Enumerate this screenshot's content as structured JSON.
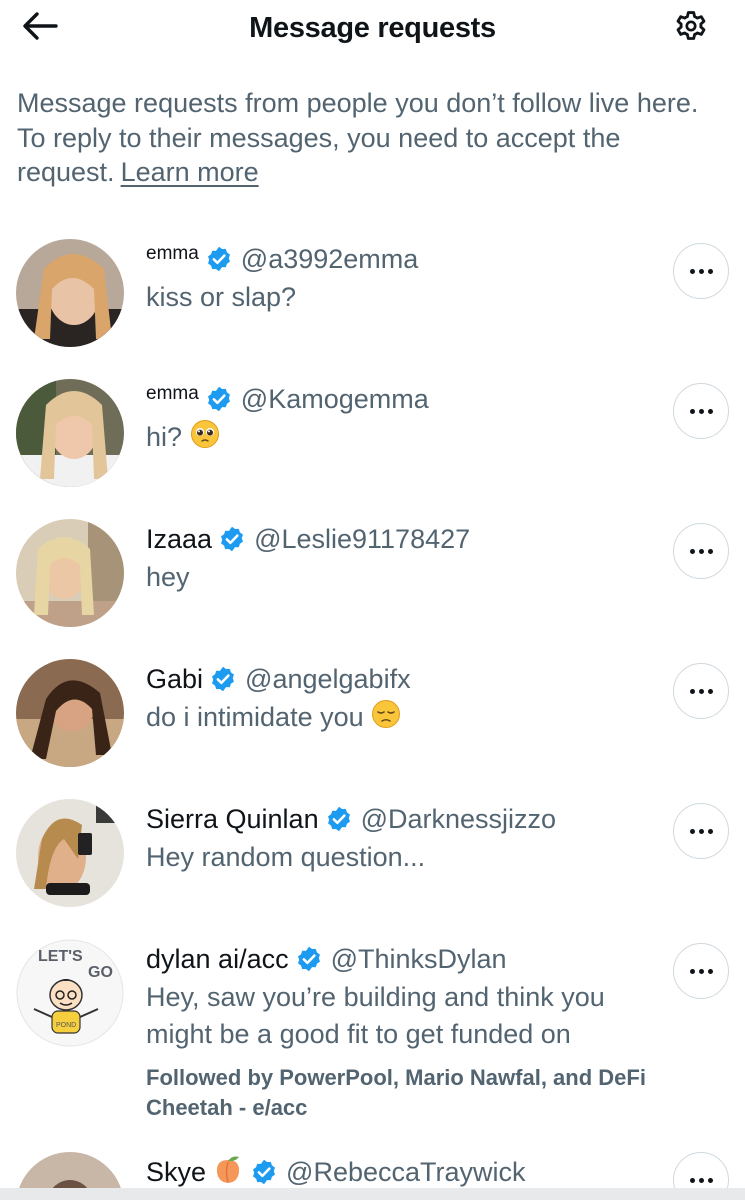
{
  "header": {
    "title": "Message requests",
    "back_icon": "arrow-left-icon",
    "settings_icon": "gear-icon"
  },
  "intro": {
    "text": "Message requests from people you don’t follow live here. To reply to their messages, you need to accept the request.",
    "learn_more": "Learn more"
  },
  "colors": {
    "verified": "#1d9bf0",
    "secondary_text": "#536471",
    "primary_text": "#0f1419",
    "border": "#cfd9de"
  },
  "requests": [
    {
      "name": "emma",
      "handle": "@a3992emma",
      "message": "kiss or slap?",
      "verified": true
    },
    {
      "name": "emma",
      "handle": "@Kamogemma",
      "message": "hi?",
      "emoji": "pleading-face-emoji",
      "verified": true
    },
    {
      "name": "Izaaa",
      "handle": "@Leslie91178427",
      "message": "hey",
      "verified": true
    },
    {
      "name": "Gabi",
      "handle": "@angelgabifx",
      "message": "do i intimidate you",
      "emoji": "pensive-face-emoji",
      "verified": true
    },
    {
      "name": "Sierra Quinlan",
      "handle": "@Darknessjizzo",
      "message": "Hey random question...",
      "verified": true
    },
    {
      "name": "dylan ai/acc",
      "handle": "@ThinksDylan",
      "message": "Hey, saw you’re building and think you might be a good fit to get funded on",
      "followed_by": "Followed by PowerPool, Mario Nawfal, and DeFi Cheetah - e/acc",
      "verified": true,
      "avatar_text": [
        "LET'S",
        "GO",
        "POND"
      ]
    },
    {
      "name": "Skye",
      "name_emoji": "peach-emoji",
      "handle": "@RebeccaTraywick",
      "verified": true
    }
  ]
}
